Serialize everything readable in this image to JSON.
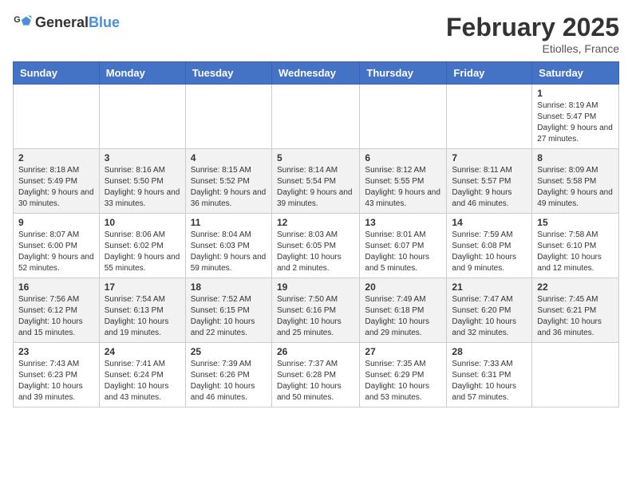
{
  "header": {
    "logo_general": "General",
    "logo_blue": "Blue",
    "title": "February 2025",
    "subtitle": "Etiolles, France"
  },
  "days_of_week": [
    "Sunday",
    "Monday",
    "Tuesday",
    "Wednesday",
    "Thursday",
    "Friday",
    "Saturday"
  ],
  "weeks": [
    [
      {
        "day": "",
        "info": ""
      },
      {
        "day": "",
        "info": ""
      },
      {
        "day": "",
        "info": ""
      },
      {
        "day": "",
        "info": ""
      },
      {
        "day": "",
        "info": ""
      },
      {
        "day": "",
        "info": ""
      },
      {
        "day": "1",
        "info": "Sunrise: 8:19 AM\nSunset: 5:47 PM\nDaylight: 9 hours and 27 minutes."
      }
    ],
    [
      {
        "day": "2",
        "info": "Sunrise: 8:18 AM\nSunset: 5:49 PM\nDaylight: 9 hours and 30 minutes."
      },
      {
        "day": "3",
        "info": "Sunrise: 8:16 AM\nSunset: 5:50 PM\nDaylight: 9 hours and 33 minutes."
      },
      {
        "day": "4",
        "info": "Sunrise: 8:15 AM\nSunset: 5:52 PM\nDaylight: 9 hours and 36 minutes."
      },
      {
        "day": "5",
        "info": "Sunrise: 8:14 AM\nSunset: 5:54 PM\nDaylight: 9 hours and 39 minutes."
      },
      {
        "day": "6",
        "info": "Sunrise: 8:12 AM\nSunset: 5:55 PM\nDaylight: 9 hours and 43 minutes."
      },
      {
        "day": "7",
        "info": "Sunrise: 8:11 AM\nSunset: 5:57 PM\nDaylight: 9 hours and 46 minutes."
      },
      {
        "day": "8",
        "info": "Sunrise: 8:09 AM\nSunset: 5:58 PM\nDaylight: 9 hours and 49 minutes."
      }
    ],
    [
      {
        "day": "9",
        "info": "Sunrise: 8:07 AM\nSunset: 6:00 PM\nDaylight: 9 hours and 52 minutes."
      },
      {
        "day": "10",
        "info": "Sunrise: 8:06 AM\nSunset: 6:02 PM\nDaylight: 9 hours and 55 minutes."
      },
      {
        "day": "11",
        "info": "Sunrise: 8:04 AM\nSunset: 6:03 PM\nDaylight: 9 hours and 59 minutes."
      },
      {
        "day": "12",
        "info": "Sunrise: 8:03 AM\nSunset: 6:05 PM\nDaylight: 10 hours and 2 minutes."
      },
      {
        "day": "13",
        "info": "Sunrise: 8:01 AM\nSunset: 6:07 PM\nDaylight: 10 hours and 5 minutes."
      },
      {
        "day": "14",
        "info": "Sunrise: 7:59 AM\nSunset: 6:08 PM\nDaylight: 10 hours and 9 minutes."
      },
      {
        "day": "15",
        "info": "Sunrise: 7:58 AM\nSunset: 6:10 PM\nDaylight: 10 hours and 12 minutes."
      }
    ],
    [
      {
        "day": "16",
        "info": "Sunrise: 7:56 AM\nSunset: 6:12 PM\nDaylight: 10 hours and 15 minutes."
      },
      {
        "day": "17",
        "info": "Sunrise: 7:54 AM\nSunset: 6:13 PM\nDaylight: 10 hours and 19 minutes."
      },
      {
        "day": "18",
        "info": "Sunrise: 7:52 AM\nSunset: 6:15 PM\nDaylight: 10 hours and 22 minutes."
      },
      {
        "day": "19",
        "info": "Sunrise: 7:50 AM\nSunset: 6:16 PM\nDaylight: 10 hours and 25 minutes."
      },
      {
        "day": "20",
        "info": "Sunrise: 7:49 AM\nSunset: 6:18 PM\nDaylight: 10 hours and 29 minutes."
      },
      {
        "day": "21",
        "info": "Sunrise: 7:47 AM\nSunset: 6:20 PM\nDaylight: 10 hours and 32 minutes."
      },
      {
        "day": "22",
        "info": "Sunrise: 7:45 AM\nSunset: 6:21 PM\nDaylight: 10 hours and 36 minutes."
      }
    ],
    [
      {
        "day": "23",
        "info": "Sunrise: 7:43 AM\nSunset: 6:23 PM\nDaylight: 10 hours and 39 minutes."
      },
      {
        "day": "24",
        "info": "Sunrise: 7:41 AM\nSunset: 6:24 PM\nDaylight: 10 hours and 43 minutes."
      },
      {
        "day": "25",
        "info": "Sunrise: 7:39 AM\nSunset: 6:26 PM\nDaylight: 10 hours and 46 minutes."
      },
      {
        "day": "26",
        "info": "Sunrise: 7:37 AM\nSunset: 6:28 PM\nDaylight: 10 hours and 50 minutes."
      },
      {
        "day": "27",
        "info": "Sunrise: 7:35 AM\nSunset: 6:29 PM\nDaylight: 10 hours and 53 minutes."
      },
      {
        "day": "28",
        "info": "Sunrise: 7:33 AM\nSunset: 6:31 PM\nDaylight: 10 hours and 57 minutes."
      },
      {
        "day": "",
        "info": ""
      }
    ]
  ]
}
